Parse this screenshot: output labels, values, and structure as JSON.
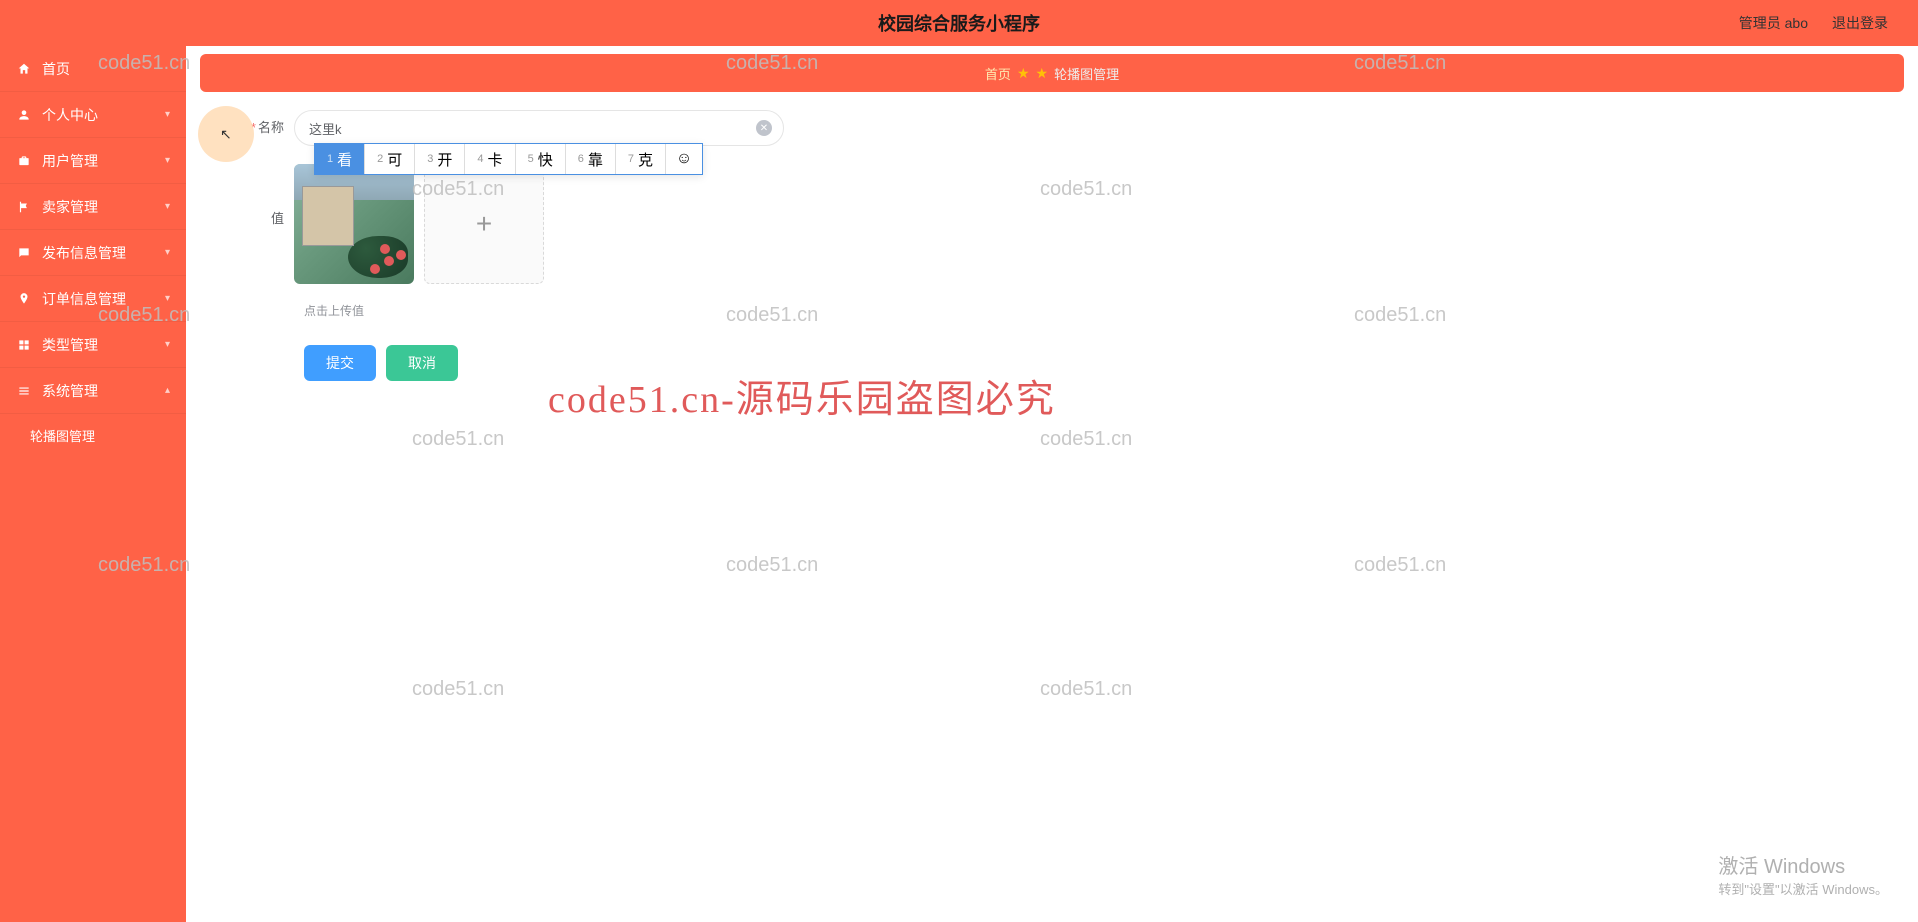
{
  "header": {
    "title": "校园综合服务小程序",
    "admin_label": "管理员 abo",
    "logout_label": "退出登录"
  },
  "sidebar": {
    "items": [
      {
        "label": "首页",
        "icon": "home"
      },
      {
        "label": "个人中心",
        "icon": "user"
      },
      {
        "label": "用户管理",
        "icon": "briefcase"
      },
      {
        "label": "卖家管理",
        "icon": "flag"
      },
      {
        "label": "发布信息管理",
        "icon": "chat"
      },
      {
        "label": "订单信息管理",
        "icon": "pin"
      },
      {
        "label": "类型管理",
        "icon": "grid"
      },
      {
        "label": "系统管理",
        "icon": "settings"
      }
    ],
    "sub": {
      "label": "轮播图管理"
    }
  },
  "breadcrumb": {
    "home": "首页",
    "current": "轮播图管理"
  },
  "form": {
    "name_label": "名称",
    "name_value": "这里k",
    "value_label": "值",
    "upload_hint": "点击上传值",
    "submit_label": "提交",
    "cancel_label": "取消"
  },
  "ime": {
    "candidates": [
      {
        "n": "1",
        "ch": "看"
      },
      {
        "n": "2",
        "ch": "可"
      },
      {
        "n": "3",
        "ch": "开"
      },
      {
        "n": "4",
        "ch": "卡"
      },
      {
        "n": "5",
        "ch": "快"
      },
      {
        "n": "6",
        "ch": "靠"
      },
      {
        "n": "7",
        "ch": "克"
      }
    ]
  },
  "watermarks": {
    "text": "code51.cn",
    "big": "code51.cn-源码乐园盗图必究"
  },
  "windows": {
    "l1": "激活 Windows",
    "l2": "转到\"设置\"以激活 Windows。"
  }
}
